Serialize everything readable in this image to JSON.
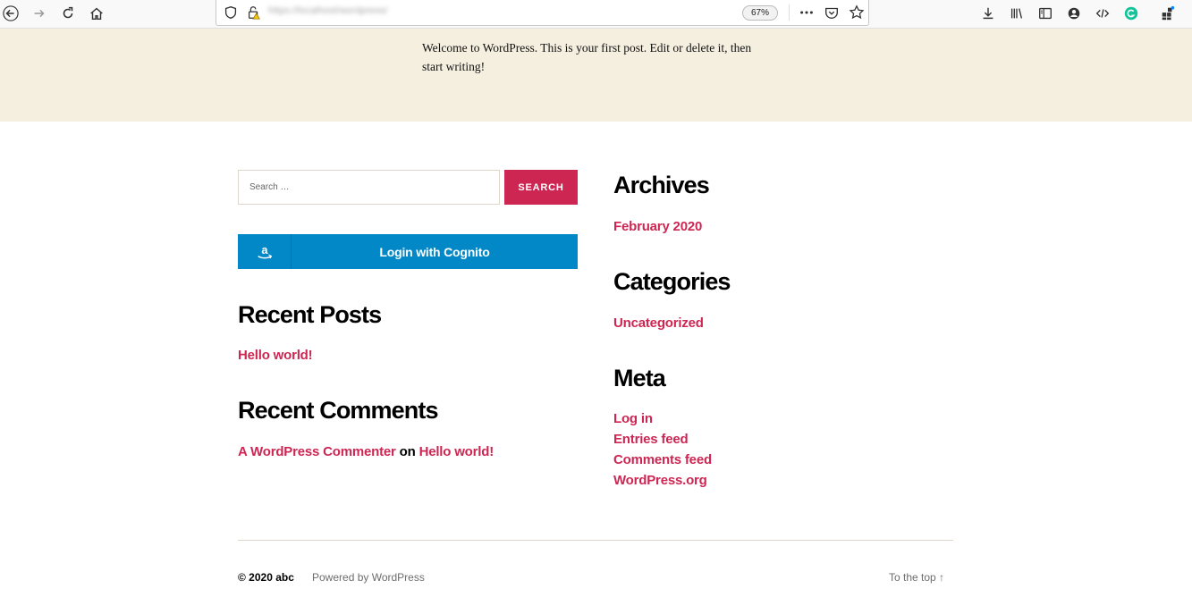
{
  "browser": {
    "url": "https://localhost/wordpress/",
    "zoom": "67%"
  },
  "hero": {
    "text": "Welcome to WordPress. This is your first post. Edit or delete it, then start writing!"
  },
  "search": {
    "placeholder": "Search …",
    "button_label": "SEARCH"
  },
  "cognito": {
    "label": "Login with Cognito",
    "icon": "amazon-icon"
  },
  "recent_posts": {
    "title": "Recent Posts",
    "items": [
      "Hello world!"
    ]
  },
  "recent_comments": {
    "title": "Recent Comments",
    "author": "A WordPress Commenter",
    "connector": "on",
    "post": "Hello world!"
  },
  "archives": {
    "title": "Archives",
    "items": [
      "February 2020"
    ]
  },
  "categories": {
    "title": "Categories",
    "items": [
      "Uncategorized"
    ]
  },
  "meta": {
    "title": "Meta",
    "items": [
      "Log in",
      "Entries feed",
      "Comments feed",
      "WordPress.org"
    ]
  },
  "footer": {
    "copyright": "© 2020 abc",
    "powered": "Powered by WordPress",
    "to_top": "To the top ↑"
  },
  "colors": {
    "accent": "#cd2653",
    "cognito": "#0288c7",
    "hero_bg": "#f5efe0"
  }
}
